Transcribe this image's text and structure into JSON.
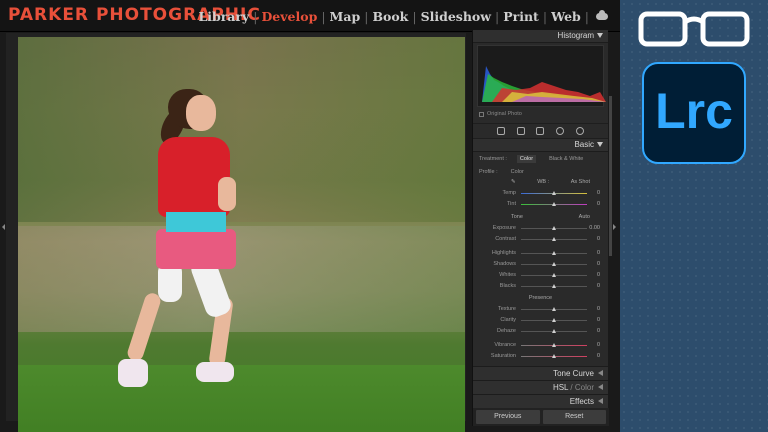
{
  "brand": "Parker Photographic",
  "modules": [
    "Library",
    "Develop",
    "Map",
    "Book",
    "Slideshow",
    "Print",
    "Web"
  ],
  "active_module": "Develop",
  "panel": {
    "histogram": {
      "title": "Histogram",
      "original_photo": "Original Photo"
    },
    "basic": {
      "title": "Basic",
      "treatment_label": "Treatment :",
      "treatment_options": [
        "Color",
        "Black & White"
      ],
      "profile_label": "Profile :",
      "profile_value": "Color",
      "wb_label": "WB :",
      "wb_value": "As Shot",
      "temp": {
        "label": "Temp",
        "value": "0"
      },
      "tint": {
        "label": "Tint",
        "value": "0"
      },
      "tone_label": "Tone",
      "auto_label": "Auto",
      "exposure": {
        "label": "Exposure",
        "value": "0.00"
      },
      "contrast": {
        "label": "Contrast",
        "value": "0"
      },
      "highlights": {
        "label": "Highlights",
        "value": "0"
      },
      "shadows": {
        "label": "Shadows",
        "value": "0"
      },
      "whites": {
        "label": "Whites",
        "value": "0"
      },
      "blacks": {
        "label": "Blacks",
        "value": "0"
      },
      "presence_label": "Presence",
      "texture": {
        "label": "Texture",
        "value": "0"
      },
      "clarity": {
        "label": "Clarity",
        "value": "0"
      },
      "dehaze": {
        "label": "Dehaze",
        "value": "0"
      },
      "vibrance": {
        "label": "Vibrance",
        "value": "0"
      },
      "saturation": {
        "label": "Saturation",
        "value": "0"
      }
    },
    "tone_curve": "Tone Curve",
    "hsl": {
      "a": "HSL",
      "sep": " / ",
      "b": "Color"
    },
    "effects": "Effects",
    "previous": "Previous",
    "reset": "Reset"
  },
  "deco": {
    "logo_text": "Lrc",
    "accent": "#31a8ff",
    "bg": "#2d4d6c"
  },
  "colors": {
    "brand": "#e8503a"
  }
}
